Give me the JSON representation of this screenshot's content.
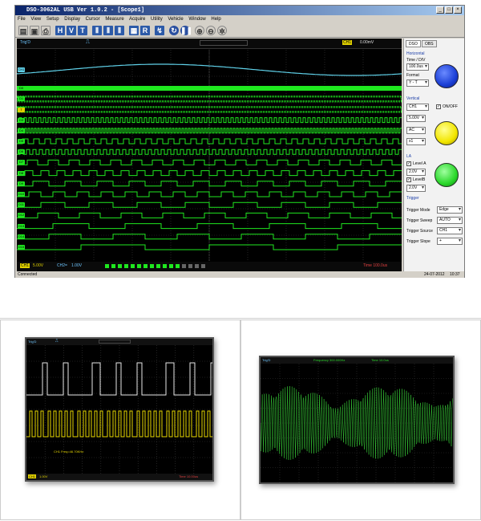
{
  "app": {
    "title": "DSO-3062AL USB Ver 1.0.2 - [Scope1]",
    "menu": [
      "File",
      "View",
      "Setup",
      "Display",
      "Cursor",
      "Measure",
      "Acquire",
      "Utility",
      "Vehicle",
      "Window",
      "Help"
    ],
    "toolbar_icons": [
      "document-icon",
      "save-icon",
      "print-icon",
      "letter-h-icon",
      "letter-v-icon",
      "letter-t-icon",
      "channel-a-icon",
      "channel-b-icon",
      "channel-c-icon",
      "grid-icon",
      "letter-r-icon",
      "probe-icon",
      "refresh-icon",
      "pause-icon",
      "zoom-in-icon",
      "zoom-out-icon",
      "settings-icon"
    ],
    "toolbar_letters": {
      "h": "H",
      "v": "V",
      "t": "T",
      "r": "R"
    },
    "scope_header": {
      "mode": "Trig'D",
      "right": "CH1",
      "right_value": "0.00mV"
    },
    "scope_footer": {
      "ch1": "CH1",
      "ch1_val": "5.00V",
      "ch2": "CH2=",
      "ch2_val": "1.00V",
      "time": "Time 100.0us"
    },
    "channel_labels": [
      "CH1",
      "D0",
      "D1",
      "D2",
      "D3",
      "D4",
      "D5",
      "D6",
      "D7",
      "D8",
      "D9",
      "D10",
      "D11",
      "D12",
      "D13",
      "D14",
      "D15"
    ],
    "side": {
      "tabs": [
        "DSO",
        "OBS"
      ],
      "horizontal_title": "Horizontal",
      "time_div_label": "Time / DIV",
      "time_div_value": "100.0us",
      "format_label": "Format",
      "format_value": "Y - T",
      "vertical_title": "Vertical",
      "channel_value": "CH1",
      "onoff_label": "ON/OFF",
      "volts_value": "5.00V",
      "coupling_value": "AC",
      "probe_value": "x1",
      "la_title": "LA",
      "level_a_label": "Level A",
      "level_a_value": "2.0V",
      "level_b_label": "LevelB",
      "level_b_value": "2.0V",
      "trigger_title": "Trigger",
      "trigger_mode_label": "Trigger Mode",
      "trigger_mode_value": "Edge",
      "trigger_sweep_label": "Trigger Sweep",
      "trigger_sweep_value": "AUTO",
      "trigger_source_label": "Trigger Source",
      "trigger_source_value": "CH1",
      "trigger_slope_label": "Trigger Slope",
      "trigger_slope_value": "+"
    },
    "status": {
      "left": "Connected",
      "right_date": "24-07-2012",
      "right_time": "10:37"
    },
    "colors": {
      "blue_knob": "#1b3fd6",
      "yellow_knob": "#f2e600",
      "green_knob": "#2bd82b",
      "la_green": "#1fe81f",
      "ch1_cyan": "#5fd0e8"
    }
  },
  "panel_left": {
    "header_left": "Trig'D",
    "footer_left": "CH1",
    "footer_val": "1.00V",
    "footer_right": "Time 10.00us",
    "annotation": "CH1 Freq=46.70KHz"
  },
  "panel_right": {
    "header_left": "Trig'D",
    "header_mid": "Frequency 300.000Hz",
    "header_right": "Time 10.0us"
  }
}
